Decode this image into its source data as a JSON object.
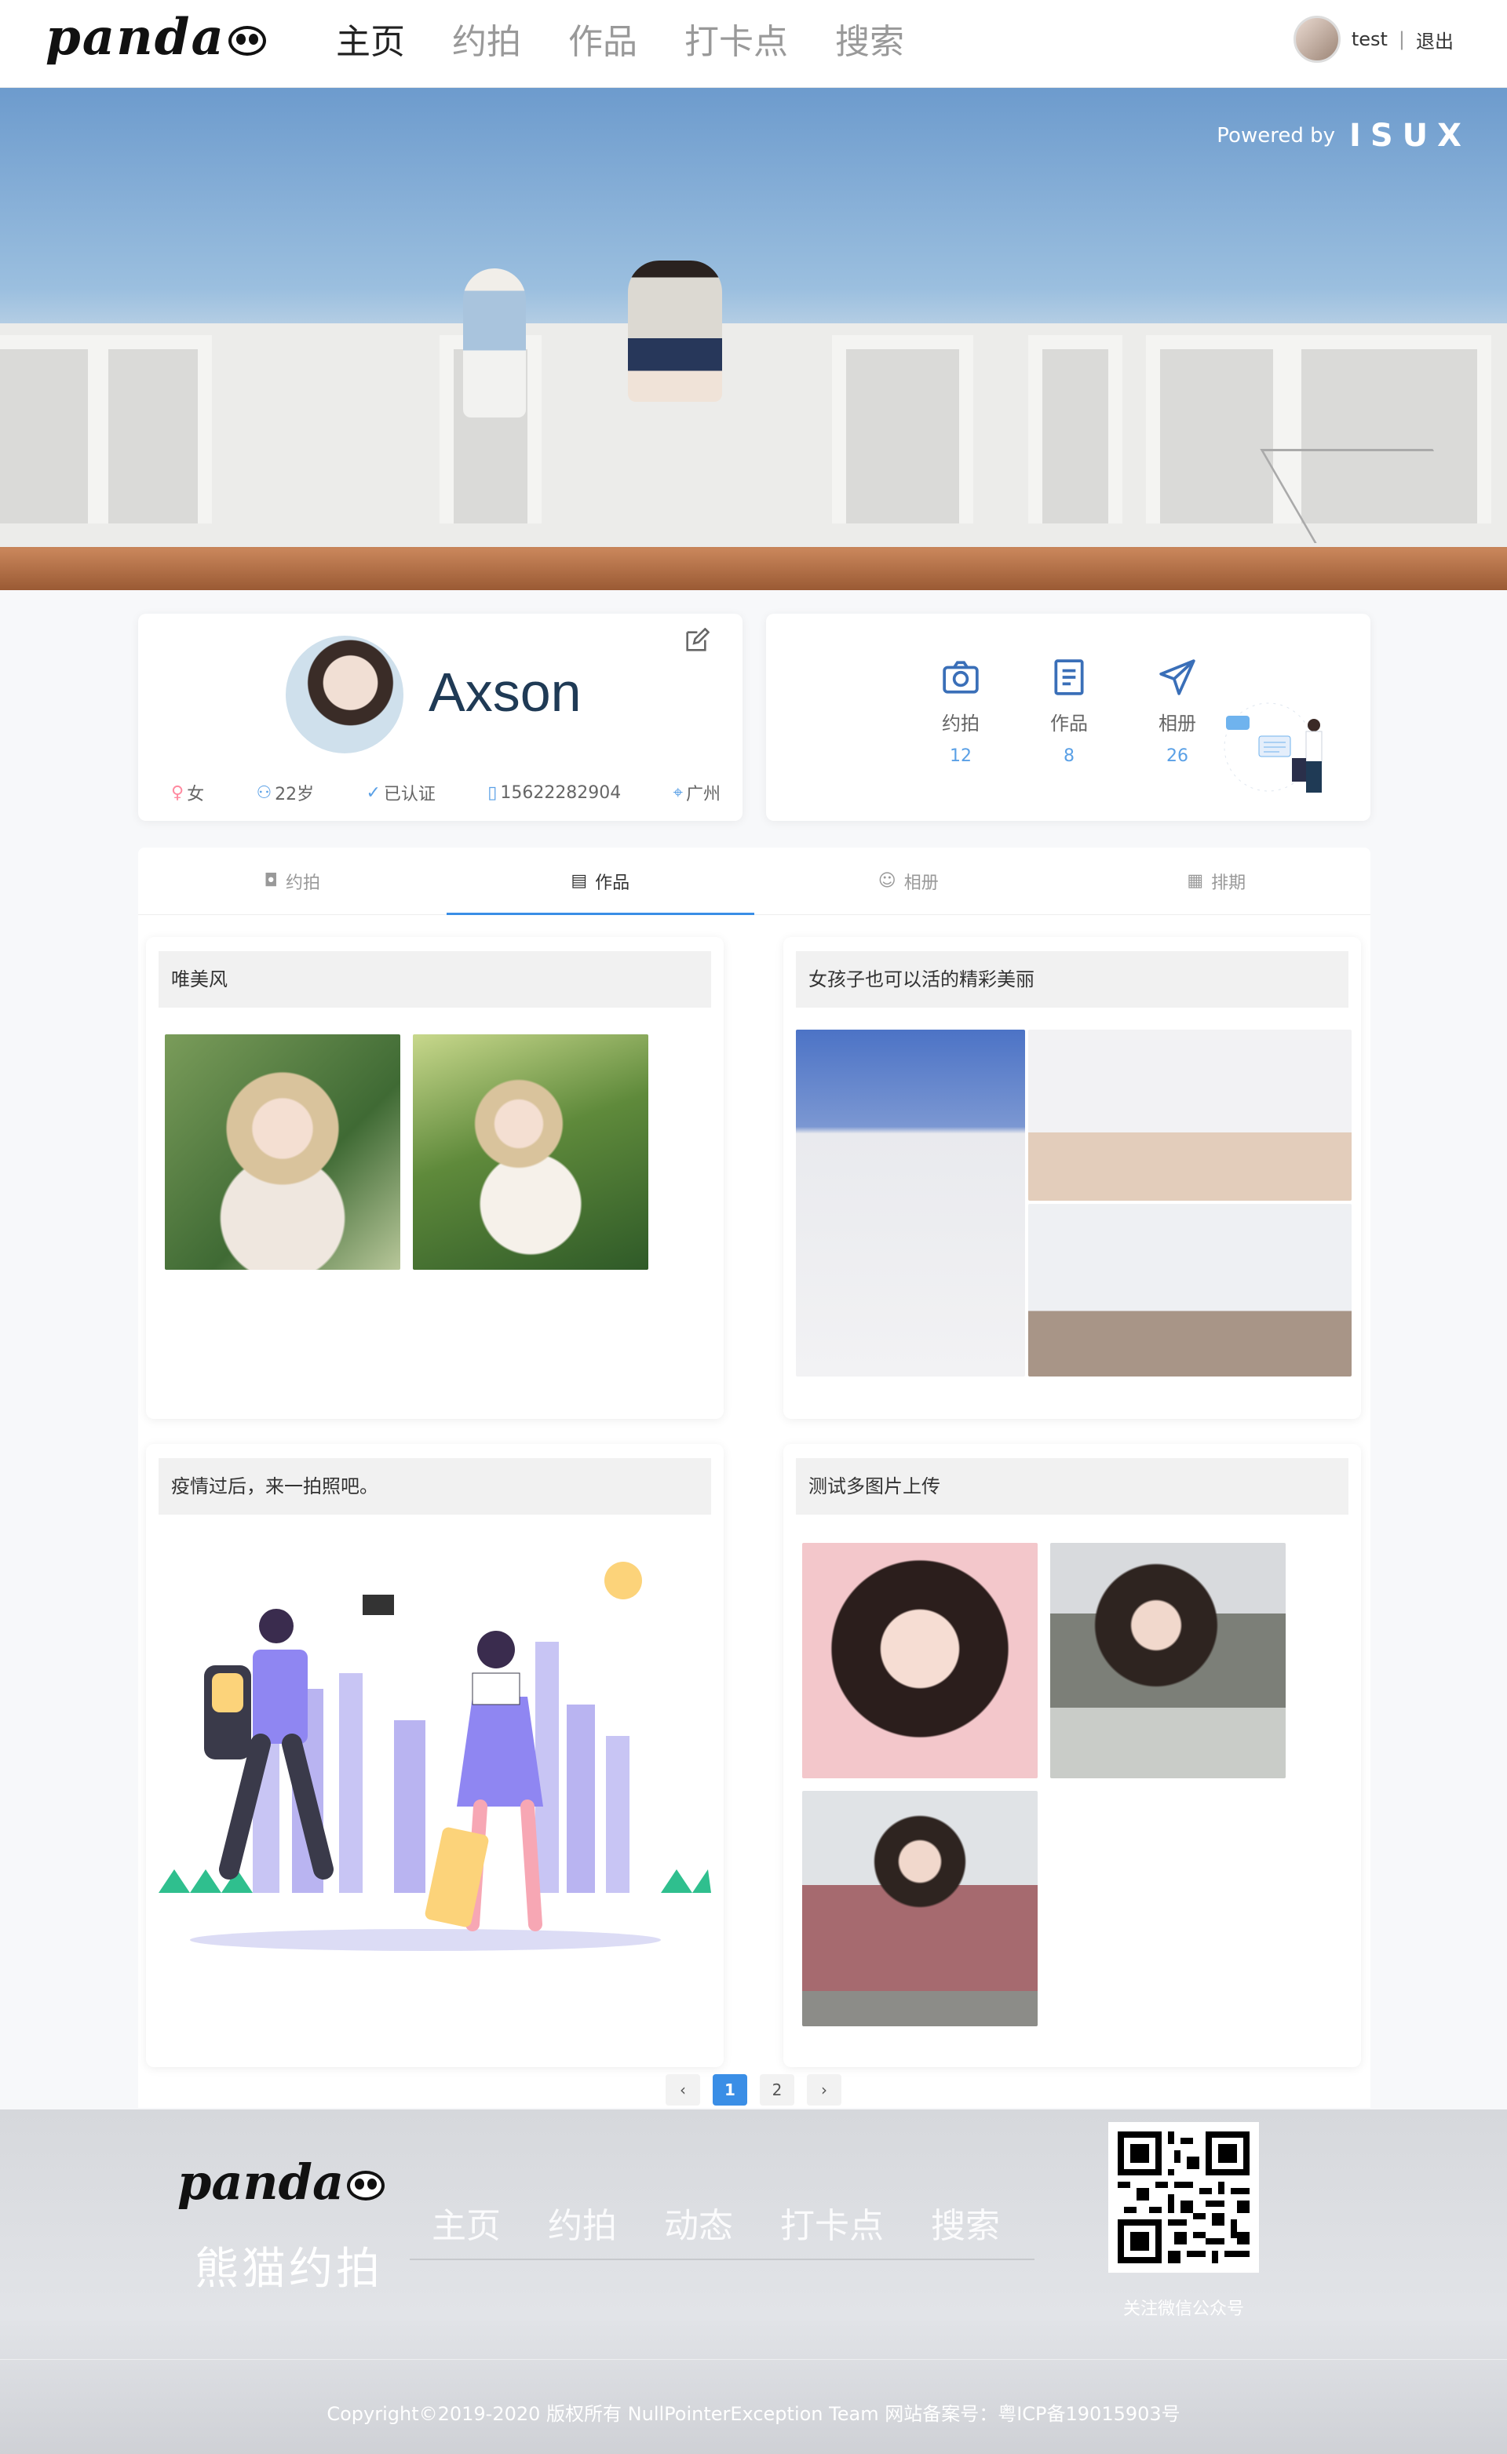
{
  "header": {
    "logo_text": "panda",
    "nav": [
      "主页",
      "约拍",
      "作品",
      "打卡点",
      "搜索"
    ],
    "user": {
      "name": "test",
      "logout": "退出",
      "separator": "|"
    }
  },
  "banner": {
    "powered_by": "Powered by",
    "brand": "ISUX"
  },
  "profile": {
    "name": "Axson",
    "gender": "女",
    "age": "22岁",
    "verified": "已认证",
    "phone": "15622282904",
    "city": "广州"
  },
  "stats": [
    {
      "label": "约拍",
      "count": "12",
      "icon": "camera-icon"
    },
    {
      "label": "作品",
      "count": "8",
      "icon": "document-icon"
    },
    {
      "label": "相册",
      "count": "26",
      "icon": "send-icon"
    }
  ],
  "tabs": [
    {
      "label": "约拍",
      "icon": "camera-icon",
      "active": false
    },
    {
      "label": "作品",
      "icon": "document-icon",
      "active": true
    },
    {
      "label": "相册",
      "icon": "smile-icon",
      "active": false
    },
    {
      "label": "排期",
      "icon": "calendar-icon",
      "active": false
    }
  ],
  "works": [
    {
      "title": "唯美风"
    },
    {
      "title": "女孩子也可以活的精彩美丽"
    },
    {
      "title": "疫情过后，来一拍照吧。"
    },
    {
      "title": "测试多图片上传"
    }
  ],
  "pagination": {
    "prev": "‹",
    "pages": [
      "1",
      "2"
    ],
    "current": "1",
    "next": "›"
  },
  "footer": {
    "logo_text": "panda",
    "subtitle": "熊猫约拍",
    "nav": [
      "主页",
      "约拍",
      "动态",
      "打卡点",
      "搜索"
    ],
    "qr_label": "关注微信公众号",
    "copyright": "Copyright©2019-2020 版权所有 NullPointerException Team 网站备案号：粤ICP备19015903号"
  },
  "colors": {
    "accent": "#3a8ee6",
    "name": "#1f3a55",
    "stat_number": "#5aa0e6"
  }
}
